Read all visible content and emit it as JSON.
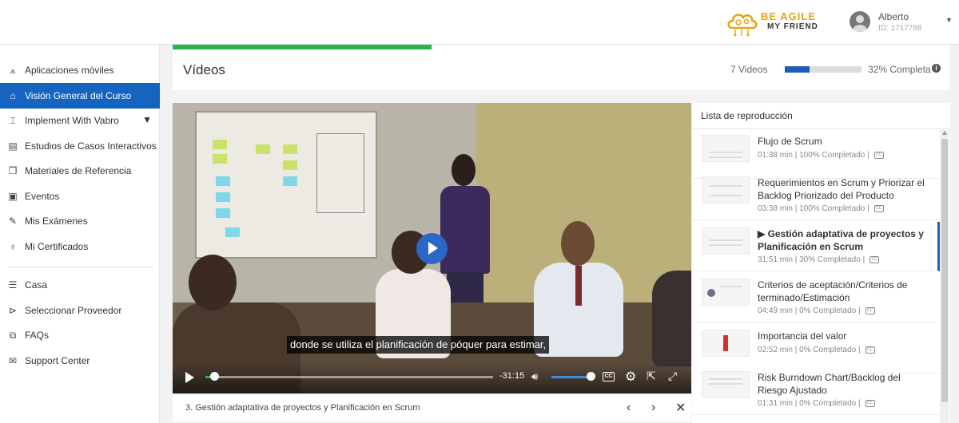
{
  "brand": {
    "line1": "BE AGILE",
    "line2": "MY FRIEND",
    "accent_color": "#e8a317"
  },
  "user": {
    "name": "Alberto",
    "id": "ID: 1717788"
  },
  "sidebar": {
    "items": [
      {
        "label": "Aplicaciones móviles",
        "icon": "mobile-apps-icon"
      },
      {
        "label": "Visión General del Curso",
        "icon": "home-icon",
        "active": true
      },
      {
        "label": "Implement With Vabro",
        "icon": "vabro-icon",
        "expandable": true
      },
      {
        "label": "Estudios de Casos Interactivos",
        "icon": "case-studies-icon"
      },
      {
        "label": "Materiales de Referencia",
        "icon": "reference-materials-icon"
      },
      {
        "label": "Eventos",
        "icon": "calendar-icon"
      },
      {
        "label": "Mis Exámenes",
        "icon": "exam-icon"
      },
      {
        "label": "Mi Certificados",
        "icon": "certificate-icon"
      },
      {
        "label": "Casa",
        "icon": "list-icon"
      },
      {
        "label": "Seleccionar Proveedor",
        "icon": "provider-icon"
      },
      {
        "label": "FAQs",
        "icon": "faq-icon"
      },
      {
        "label": "Support Center",
        "icon": "support-icon"
      }
    ],
    "active_color": "#1565c0"
  },
  "header": {
    "title": "Vídeos",
    "video_count": "7 Videos",
    "progress_percent": 32,
    "progress_label": "32% Completa"
  },
  "player": {
    "subtitle": "donde se utiliza el planificación de póquer para estimar,",
    "time_remaining": "-31:15",
    "played_fraction": 0.03,
    "volume_fraction": 0.9,
    "cc_label": "CC",
    "seek_color": "#2db34a"
  },
  "video_footer": {
    "title": "3. Gestión adaptativa de proyectos y Planificación en Scrum"
  },
  "playlist": {
    "title": "Lista de reproducción",
    "items": [
      {
        "name": "Flujo de Scrum",
        "meta": "01:38 min | 100% Completado |"
      },
      {
        "name": "Requerimientos en Scrum y Priorizar el Backlog Priorizado del Producto",
        "meta": "03:38 min | 100% Completado |"
      },
      {
        "name": "▶ Gestión adaptativa de proyectos y Planificación en Scrum",
        "meta": "31:51 min | 30% Completado |",
        "current": true
      },
      {
        "name": "Criterios de aceptación/Criterios de terminado/Estimación",
        "meta": "04:49 min | 0% Completado |"
      },
      {
        "name": "Importancia del valor",
        "meta": "02:52 min | 0% Completado |"
      },
      {
        "name": "Risk Burndown Chart/Backlog del Riesgo Ajustado",
        "meta": "01:31 min | 0% Completado |"
      }
    ]
  }
}
